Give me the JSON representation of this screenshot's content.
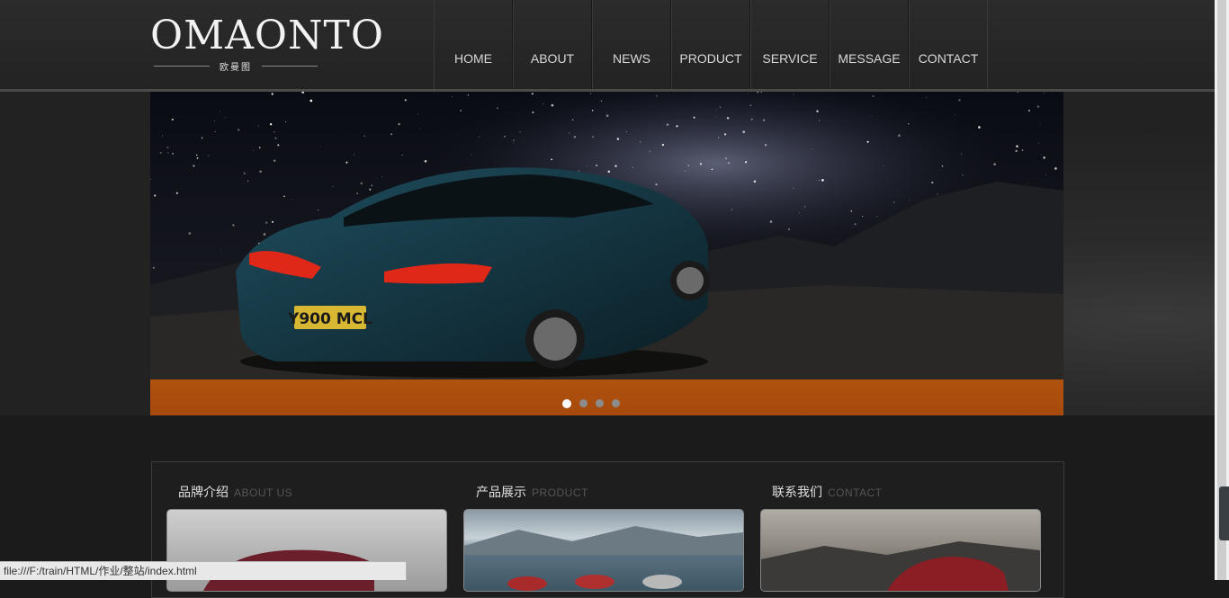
{
  "logo": {
    "title": "OMAONTO",
    "subtitle": "欧曼图"
  },
  "nav": [
    "HOME",
    "ABOUT",
    "NEWS",
    "PRODUCT",
    "SERVICE",
    "MESSAGE",
    "CONTACT"
  ],
  "banner": {
    "plate": "Y900 MCL",
    "dots": 4,
    "active_dot": 0
  },
  "sections": [
    {
      "cn": "品牌介绍",
      "en": "ABOUT US"
    },
    {
      "cn": "产品展示",
      "en": "PRODUCT"
    },
    {
      "cn": "联系我们",
      "en": "CONTACT"
    }
  ],
  "status_url": "file:///F:/train/HTML/作业/整站/index.html",
  "colors": {
    "accent": "#b0520f",
    "header_bg": "#262626",
    "page_bg": "#1b1b1b"
  }
}
